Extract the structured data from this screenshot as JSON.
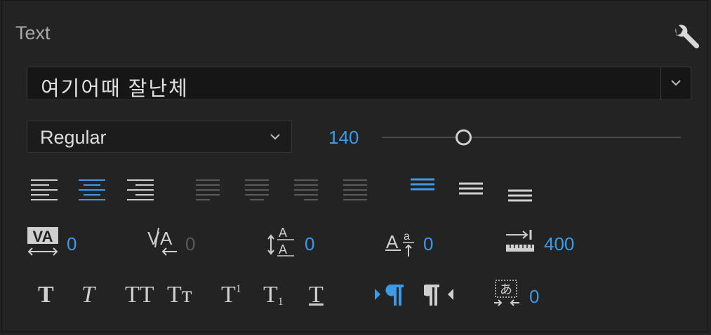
{
  "panel": {
    "title": "Text"
  },
  "font": {
    "family": "여기어때 잘난체",
    "style": "Regular",
    "size": "140"
  },
  "size_slider": {
    "value": 140,
    "min": 0,
    "max": 512
  },
  "metrics": {
    "kerning": "0",
    "tracking": "0",
    "leading": "0",
    "baseline_shift": "0",
    "tab_width": "400",
    "tsume": "0"
  },
  "icons": {
    "wrench": "wrench-icon",
    "align_left": "align-left-icon",
    "align_center": "align-center-icon",
    "align_right": "align-right-icon",
    "justify_last_left": "justify-last-left-icon",
    "justify_last_center": "justify-last-center-icon",
    "justify_last_right": "justify-last-right-icon",
    "justify_all": "justify-all-icon",
    "align_top": "align-top-icon",
    "align_middle": "align-middle-icon",
    "align_bottom": "align-bottom-icon"
  },
  "type_styles": {
    "bold": "T",
    "italic": "T",
    "all_caps": "TT",
    "small_caps": "Tт",
    "superscript": "T",
    "superscript_mark": "1",
    "subscript": "T",
    "subscript_mark": "1",
    "underline": "T"
  },
  "colors": {
    "accent": "#3d9ae8",
    "background": "#232323",
    "field": "#161616",
    "icon": "#cfcfcf",
    "icon_dim": "#5a5a5a"
  }
}
